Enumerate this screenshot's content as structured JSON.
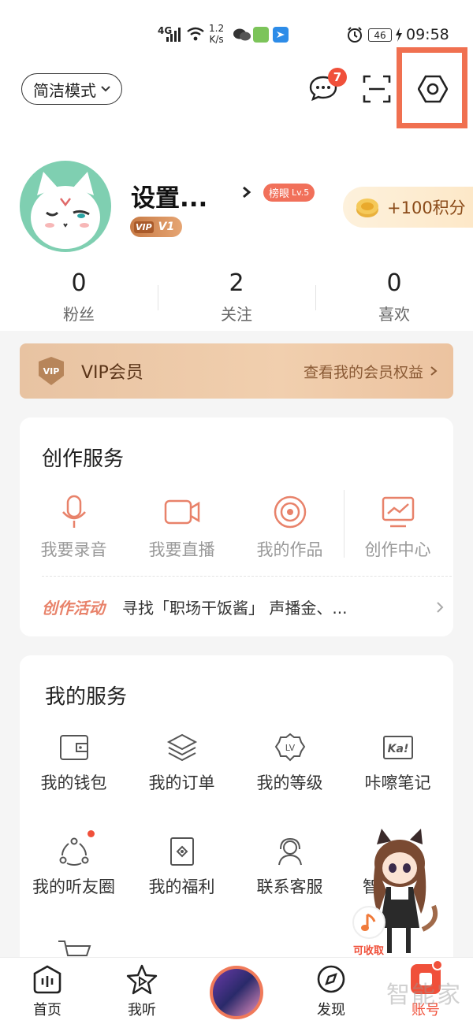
{
  "status_bar": {
    "network": "4G",
    "speed_value": "1.2",
    "speed_unit": "K/s",
    "battery": "46",
    "time": "09:58"
  },
  "header": {
    "mode_label": "简洁模式",
    "message_badge": "7"
  },
  "profile": {
    "name": "设置...",
    "rank_label": "榜眼",
    "rank_level": "Lv.5",
    "vip_level": "V1",
    "points_label": "+100积分"
  },
  "stats": [
    {
      "value": "0",
      "label": "粉丝"
    },
    {
      "value": "2",
      "label": "关注"
    },
    {
      "value": "0",
      "label": "喜欢"
    }
  ],
  "vip_bar": {
    "title": "VIP会员",
    "link": "查看我的会员权益"
  },
  "creation": {
    "title": "创作服务",
    "items": [
      {
        "label": "我要录音",
        "icon": "microphone-icon"
      },
      {
        "label": "我要直播",
        "icon": "video-camera-icon"
      },
      {
        "label": "我的作品",
        "icon": "disc-icon"
      },
      {
        "label": "创作中心",
        "icon": "monitor-chart-icon"
      }
    ],
    "activity_tag": "创作活动",
    "activity_text": "寻找「职场干饭酱」 声播金、..."
  },
  "my_services": {
    "title": "我的服务",
    "row1": [
      {
        "label": "我的钱包",
        "icon": "wallet-icon"
      },
      {
        "label": "我的订单",
        "icon": "layers-icon"
      },
      {
        "label": "我的等级",
        "icon": "level-badge-icon"
      },
      {
        "label": "咔嚓笔记",
        "icon": "ka-note-icon"
      }
    ],
    "row2": [
      {
        "label": "我的听友圈",
        "icon": "circle-friends-icon"
      },
      {
        "label": "我的福利",
        "icon": "gift-card-icon"
      },
      {
        "label": "联系客服",
        "icon": "headset-icon"
      },
      {
        "label": "智",
        "icon": "partial-icon"
      }
    ],
    "mascot_caption": "可收取"
  },
  "tabbar": {
    "tabs": [
      {
        "label": "首页",
        "icon": "home-icon"
      },
      {
        "label": "我听",
        "icon": "star-play-icon"
      },
      {
        "label": "",
        "icon": "now-playing-cover"
      },
      {
        "label": "发现",
        "icon": "compass-icon"
      },
      {
        "label": "账号",
        "icon": "account-icon"
      }
    ]
  },
  "watermark": "智能家",
  "colors": {
    "accent": "#f0503a",
    "icon_orange": "#e8826a",
    "vip_gold": "#f1cfae"
  }
}
